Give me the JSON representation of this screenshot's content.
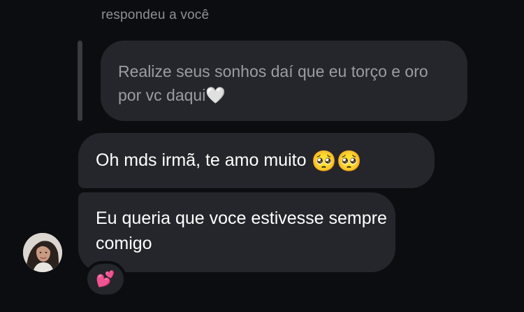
{
  "reply": {
    "header": "respondeu a você",
    "quoted_text": "Realize seus sonhos daí que eu torço e oro por vc daqui🤍"
  },
  "messages": [
    {
      "text": "Oh mds irmã, te amo muito",
      "emojis": "🥺🥺"
    },
    {
      "text": "Eu queria que voce estivesse sempre comigo"
    }
  ],
  "reaction": {
    "emoji": "💕"
  },
  "colors": {
    "background": "#0c0d11",
    "bubble": "#25262b",
    "quoted_text": "#9b9da2",
    "header_text": "#8e9095",
    "message_text": "#ffffff"
  }
}
